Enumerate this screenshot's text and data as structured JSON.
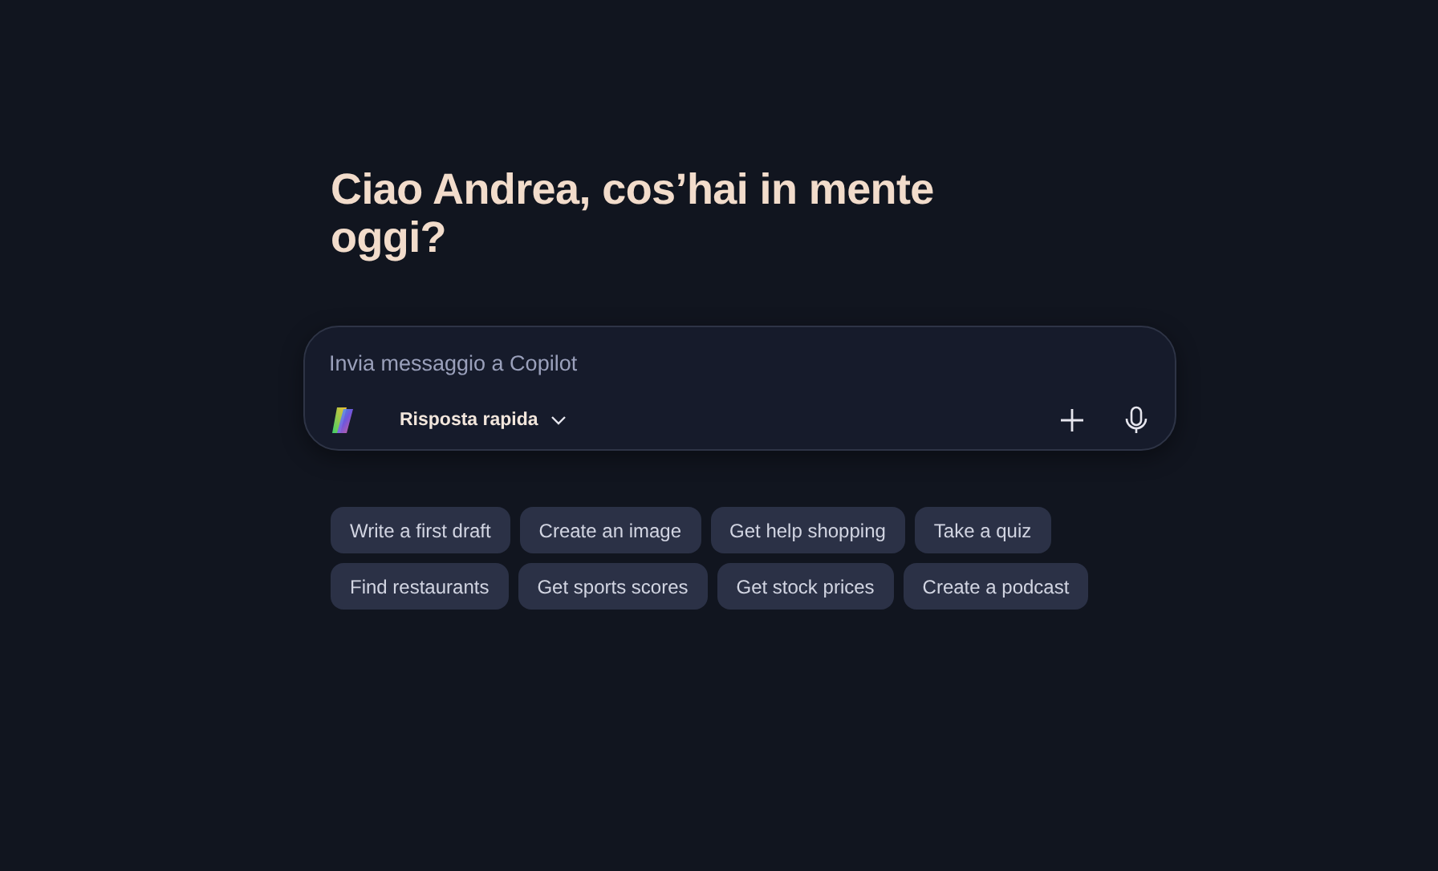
{
  "greeting": "Ciao Andrea, cos’hai in mente oggi?",
  "composer": {
    "placeholder": "Invia messaggio a Copilot",
    "mode": "Risposta rapida"
  },
  "suggestions": [
    [
      "Write a first draft",
      "Create an image",
      "Get help shopping",
      "Take a quiz"
    ],
    [
      "Find restaurants",
      "Get sports scores",
      "Get stock prices",
      "Create a podcast"
    ]
  ]
}
